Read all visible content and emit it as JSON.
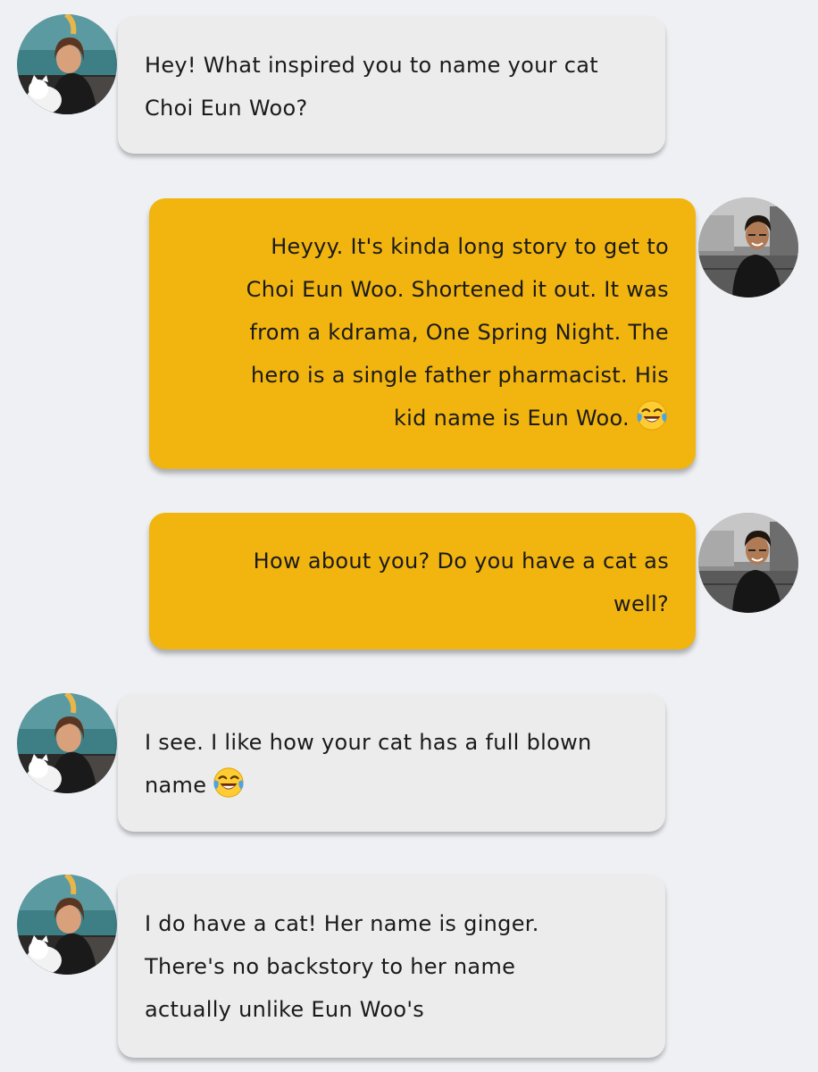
{
  "conversation": {
    "messages": [
      {
        "sender": "other",
        "lines": [
          "Hey! What inspired you to name your cat",
          "Choi Eun Woo?"
        ]
      },
      {
        "sender": "me",
        "lines": [
          "Heyyy. It's kinda long story to get to",
          "Choi Eun Woo. Shortened it out. It was",
          "from a kdrama, One Spring Night. The",
          "hero is a single father pharmacist. His",
          "kid name is Eun Woo."
        ],
        "emoji": "tears-of-joy-emoji"
      },
      {
        "sender": "me",
        "lines": [
          "How about you? Do you have a cat as",
          "well?"
        ]
      },
      {
        "sender": "other",
        "lines": [
          "I see. I like how your cat has a full blown",
          "name"
        ],
        "emoji": "tears-of-joy-emoji"
      },
      {
        "sender": "other",
        "lines": [
          "I do have a cat! Her name is ginger.",
          "There's no backstory to her name",
          "actually unlike Eun Woo's"
        ]
      }
    ]
  },
  "colors": {
    "page_background": "#eef0f4",
    "incoming_bubble": "#ececec",
    "outgoing_bubble": "#f2b50f",
    "text": "#1a1a1a"
  }
}
